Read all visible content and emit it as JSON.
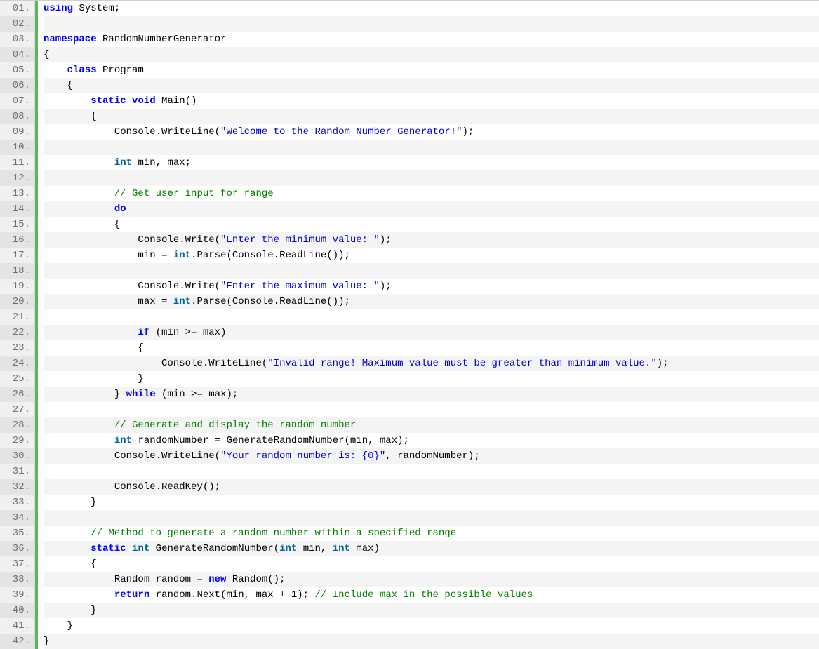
{
  "lines": [
    {
      "n": "01.",
      "segs": [
        {
          "c": "kw-blue",
          "t": "using"
        },
        {
          "c": "txt",
          "t": " System;"
        }
      ]
    },
    {
      "n": "02.",
      "segs": []
    },
    {
      "n": "03.",
      "segs": [
        {
          "c": "kw-blue",
          "t": "namespace"
        },
        {
          "c": "txt",
          "t": " RandomNumberGenerator"
        }
      ]
    },
    {
      "n": "04.",
      "segs": [
        {
          "c": "txt",
          "t": "{"
        }
      ]
    },
    {
      "n": "05.",
      "segs": [
        {
          "c": "txt",
          "t": "    "
        },
        {
          "c": "kw-blue",
          "t": "class"
        },
        {
          "c": "txt",
          "t": " Program"
        }
      ]
    },
    {
      "n": "06.",
      "segs": [
        {
          "c": "txt",
          "t": "    {"
        }
      ]
    },
    {
      "n": "07.",
      "segs": [
        {
          "c": "txt",
          "t": "        "
        },
        {
          "c": "kw-blue",
          "t": "static"
        },
        {
          "c": "txt",
          "t": " "
        },
        {
          "c": "kw-blue",
          "t": "void"
        },
        {
          "c": "txt",
          "t": " Main()"
        }
      ]
    },
    {
      "n": "08.",
      "segs": [
        {
          "c": "txt",
          "t": "        {"
        }
      ]
    },
    {
      "n": "09.",
      "segs": [
        {
          "c": "txt",
          "t": "            Console.WriteLine("
        },
        {
          "c": "str",
          "t": "\"Welcome to the Random Number Generator!\""
        },
        {
          "c": "txt",
          "t": ");"
        }
      ]
    },
    {
      "n": "10.",
      "segs": []
    },
    {
      "n": "11.",
      "segs": [
        {
          "c": "txt",
          "t": "            "
        },
        {
          "c": "kw-teal",
          "t": "int"
        },
        {
          "c": "txt",
          "t": " min, max;"
        }
      ]
    },
    {
      "n": "12.",
      "segs": []
    },
    {
      "n": "13.",
      "segs": [
        {
          "c": "txt",
          "t": "            "
        },
        {
          "c": "cmt",
          "t": "// Get user input for range"
        }
      ]
    },
    {
      "n": "14.",
      "segs": [
        {
          "c": "txt",
          "t": "            "
        },
        {
          "c": "kw-blue",
          "t": "do"
        }
      ]
    },
    {
      "n": "15.",
      "segs": [
        {
          "c": "txt",
          "t": "            {"
        }
      ]
    },
    {
      "n": "16.",
      "segs": [
        {
          "c": "txt",
          "t": "                Console.Write("
        },
        {
          "c": "str",
          "t": "\"Enter the minimum value: \""
        },
        {
          "c": "txt",
          "t": ");"
        }
      ]
    },
    {
      "n": "17.",
      "segs": [
        {
          "c": "txt",
          "t": "                min = "
        },
        {
          "c": "kw-teal",
          "t": "int"
        },
        {
          "c": "txt",
          "t": ".Parse(Console.ReadLine());"
        }
      ]
    },
    {
      "n": "18.",
      "segs": []
    },
    {
      "n": "19.",
      "segs": [
        {
          "c": "txt",
          "t": "                Console.Write("
        },
        {
          "c": "str",
          "t": "\"Enter the maximum value: \""
        },
        {
          "c": "txt",
          "t": ");"
        }
      ]
    },
    {
      "n": "20.",
      "segs": [
        {
          "c": "txt",
          "t": "                max = "
        },
        {
          "c": "kw-teal",
          "t": "int"
        },
        {
          "c": "txt",
          "t": ".Parse(Console.ReadLine());"
        }
      ]
    },
    {
      "n": "21.",
      "segs": []
    },
    {
      "n": "22.",
      "segs": [
        {
          "c": "txt",
          "t": "                "
        },
        {
          "c": "kw-blue",
          "t": "if"
        },
        {
          "c": "txt",
          "t": " (min >= max)"
        }
      ]
    },
    {
      "n": "23.",
      "segs": [
        {
          "c": "txt",
          "t": "                {"
        }
      ]
    },
    {
      "n": "24.",
      "segs": [
        {
          "c": "txt",
          "t": "                    Console.WriteLine("
        },
        {
          "c": "str",
          "t": "\"Invalid range! Maximum value must be greater than minimum value.\""
        },
        {
          "c": "txt",
          "t": ");"
        }
      ]
    },
    {
      "n": "25.",
      "segs": [
        {
          "c": "txt",
          "t": "                }"
        }
      ]
    },
    {
      "n": "26.",
      "segs": [
        {
          "c": "txt",
          "t": "            } "
        },
        {
          "c": "kw-blue",
          "t": "while"
        },
        {
          "c": "txt",
          "t": " (min >= max);"
        }
      ]
    },
    {
      "n": "27.",
      "segs": []
    },
    {
      "n": "28.",
      "segs": [
        {
          "c": "txt",
          "t": "            "
        },
        {
          "c": "cmt",
          "t": "// Generate and display the random number"
        }
      ]
    },
    {
      "n": "29.",
      "segs": [
        {
          "c": "txt",
          "t": "            "
        },
        {
          "c": "kw-teal",
          "t": "int"
        },
        {
          "c": "txt",
          "t": " randomNumber = GenerateRandomNumber(min, max);"
        }
      ]
    },
    {
      "n": "30.",
      "segs": [
        {
          "c": "txt",
          "t": "            Console.WriteLine("
        },
        {
          "c": "str",
          "t": "\"Your random number is: {0}\""
        },
        {
          "c": "txt",
          "t": ", randomNumber);"
        }
      ]
    },
    {
      "n": "31.",
      "segs": []
    },
    {
      "n": "32.",
      "segs": [
        {
          "c": "txt",
          "t": "            Console.ReadKey();"
        }
      ]
    },
    {
      "n": "33.",
      "segs": [
        {
          "c": "txt",
          "t": "        }"
        }
      ]
    },
    {
      "n": "34.",
      "segs": []
    },
    {
      "n": "35.",
      "segs": [
        {
          "c": "txt",
          "t": "        "
        },
        {
          "c": "cmt",
          "t": "// Method to generate a random number within a specified range"
        }
      ]
    },
    {
      "n": "36.",
      "segs": [
        {
          "c": "txt",
          "t": "        "
        },
        {
          "c": "kw-blue",
          "t": "static"
        },
        {
          "c": "txt",
          "t": " "
        },
        {
          "c": "kw-teal",
          "t": "int"
        },
        {
          "c": "txt",
          "t": " GenerateRandomNumber("
        },
        {
          "c": "kw-teal",
          "t": "int"
        },
        {
          "c": "txt",
          "t": " min, "
        },
        {
          "c": "kw-teal",
          "t": "int"
        },
        {
          "c": "txt",
          "t": " max)"
        }
      ]
    },
    {
      "n": "37.",
      "segs": [
        {
          "c": "txt",
          "t": "        {"
        }
      ]
    },
    {
      "n": "38.",
      "segs": [
        {
          "c": "txt",
          "t": "            Random random = "
        },
        {
          "c": "kw-blue",
          "t": "new"
        },
        {
          "c": "txt",
          "t": " Random();"
        }
      ]
    },
    {
      "n": "39.",
      "segs": [
        {
          "c": "txt",
          "t": "            "
        },
        {
          "c": "kw-blue",
          "t": "return"
        },
        {
          "c": "txt",
          "t": " random.Next(min, max + 1); "
        },
        {
          "c": "cmt",
          "t": "// Include max in the possible values"
        }
      ]
    },
    {
      "n": "40.",
      "segs": [
        {
          "c": "txt",
          "t": "        }"
        }
      ]
    },
    {
      "n": "41.",
      "segs": [
        {
          "c": "txt",
          "t": "    }"
        }
      ]
    },
    {
      "n": "42.",
      "segs": [
        {
          "c": "txt",
          "t": "}"
        }
      ]
    }
  ]
}
